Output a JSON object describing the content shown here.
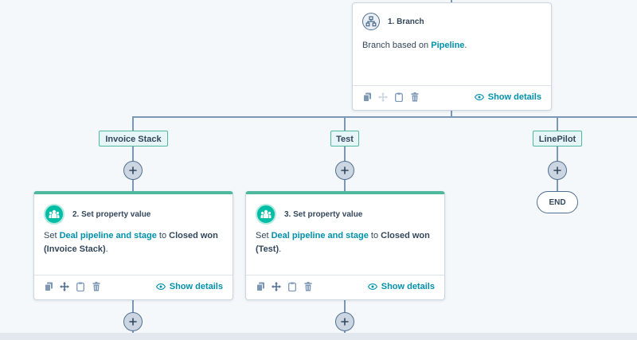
{
  "branch_card": {
    "title": "1. Branch",
    "body_prefix": "Branch based on ",
    "body_link": "Pipeline",
    "body_suffix": ".",
    "show_details": "Show details"
  },
  "branches": [
    {
      "label": "Invoice Stack"
    },
    {
      "label": "Test"
    },
    {
      "label": "LinePilot"
    }
  ],
  "actions": [
    {
      "title": "2. Set property value",
      "prefix": "Set ",
      "link": "Deal pipeline and stage",
      "middle": " to ",
      "value": "Closed won",
      "value2": "(Invoice Stack)",
      "suffix": ".",
      "show_details": "Show details"
    },
    {
      "title": "3. Set property value",
      "prefix": "Set ",
      "link": "Deal pipeline and stage",
      "middle": " to ",
      "value": "Closed won",
      "value2": "(Test)",
      "suffix": ".",
      "show_details": "Show details"
    }
  ],
  "end_label": "END",
  "colors": {
    "accent": "#0091ae",
    "action_bar": "#4fb9a0",
    "connector": "#7c98b6"
  }
}
